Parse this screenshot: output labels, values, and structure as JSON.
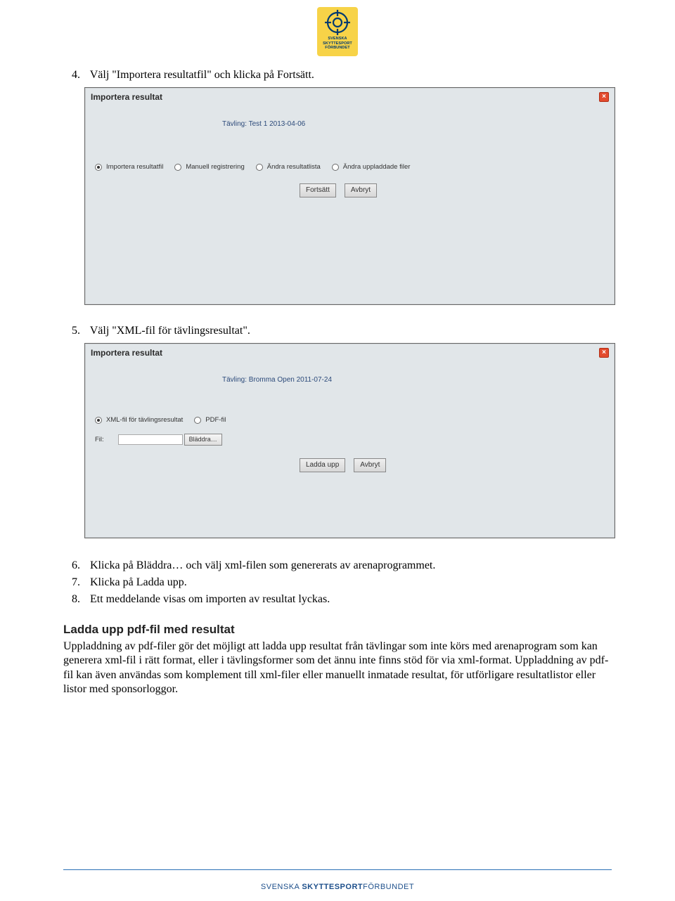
{
  "logo": {
    "line1": "SVENSKA",
    "line2": "SKYTTESPORT",
    "line3": "FÖRBUNDET"
  },
  "steps_a": {
    "num": "4.",
    "text": "Välj \"Importera resultatfil\" och klicka på Fortsätt."
  },
  "panel1": {
    "title": "Importera resultat",
    "subtitle_label": "Tävling:",
    "subtitle_value": "Test 1 2013-04-06",
    "radios": [
      "Importera resultatfil",
      "Manuell registrering",
      "Ändra resultatlista",
      "Ändra uppladdade filer"
    ],
    "btn_continue": "Fortsätt",
    "btn_cancel": "Avbryt"
  },
  "steps_b": {
    "num": "5.",
    "text": "Välj \"XML-fil för tävlingsresultat\"."
  },
  "panel2": {
    "title": "Importera resultat",
    "subtitle_label": "Tävling:",
    "subtitle_value": "Bromma Open 2011-07-24",
    "radios": [
      "XML-fil för tävlingsresultat",
      "PDF-fil"
    ],
    "file_label": "Fil:",
    "browse": "Bläddra…",
    "btn_upload": "Ladda upp",
    "btn_cancel": "Avbryt"
  },
  "steps_c": [
    {
      "num": "6.",
      "text": "Klicka på Bläddra… och välj xml-filen som genererats av arenaprogrammet."
    },
    {
      "num": "7.",
      "text": "Klicka på Ladda upp."
    },
    {
      "num": "8.",
      "text": "Ett meddelande visas om importen av resultat lyckas."
    }
  ],
  "section": {
    "heading": "Ladda upp pdf-fil med resultat",
    "body": "Uppladdning av pdf-filer gör det möjligt att ladda upp resultat från tävlingar som inte körs med arenaprogram som kan generera xml-fil i rätt format, eller i tävlingsformer som det ännu inte finns stöd för via xml-format. Uppladdning av pdf-fil kan även användas som komplement till xml-filer eller manuellt inmatade resultat, för utförligare resultatlistor eller listor med sponsorloggor."
  },
  "footer": {
    "light": "SVENSKA ",
    "bold": "SKYTTESPORT",
    "light2": "FÖRBUNDET"
  }
}
